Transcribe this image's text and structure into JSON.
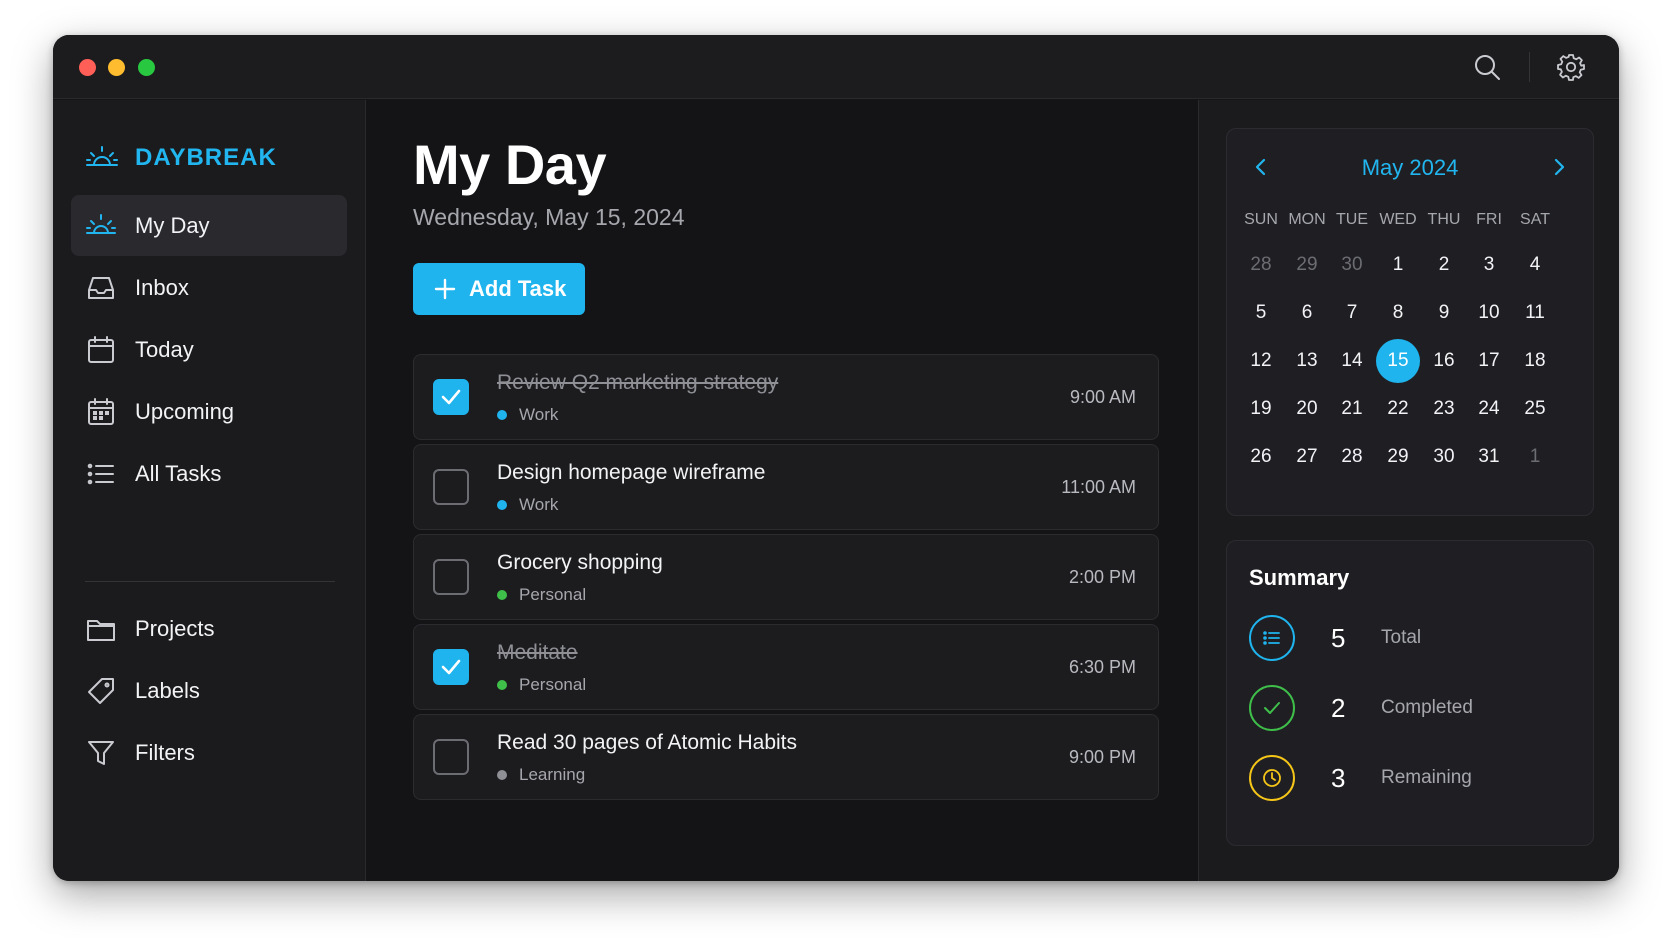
{
  "app": {
    "brand": "DAYBREAK",
    "accent": "#1fb4ee"
  },
  "titlebar": {
    "icons": [
      "search-icon",
      "gear-icon"
    ]
  },
  "sidebar": {
    "items": [
      {
        "label": "My Day",
        "icon": "sunrise-icon",
        "active": true
      },
      {
        "label": "Inbox",
        "icon": "inbox-icon"
      },
      {
        "label": "Today",
        "icon": "calendar-icon"
      },
      {
        "label": "Upcoming",
        "icon": "calendar-grid-icon"
      },
      {
        "label": "All Tasks",
        "icon": "list-icon"
      },
      {
        "label": "Projects",
        "icon": "folder-icon"
      },
      {
        "label": "Labels",
        "icon": "tag-icon"
      },
      {
        "label": "Filters",
        "icon": "filter-icon"
      }
    ]
  },
  "main": {
    "title": "My Day",
    "date": "Wednesday, May 15, 2024",
    "add_label": "Add Task",
    "tasks": [
      {
        "title": "Review Q2 marketing strategy",
        "tag": "Work",
        "tag_color": "#1fb4ee",
        "time": "9:00 AM",
        "done": true
      },
      {
        "title": "Design homepage wireframe",
        "tag": "Work",
        "tag_color": "#1fb4ee",
        "time": "11:00 AM",
        "done": false
      },
      {
        "title": "Grocery shopping",
        "tag": "Personal",
        "tag_color": "#3fbf4a",
        "time": "2:00 PM",
        "done": false
      },
      {
        "title": "Meditate",
        "tag": "Personal",
        "tag_color": "#3fbf4a",
        "time": "6:30 PM",
        "done": true
      },
      {
        "title": "Read 30 pages of Atomic Habits",
        "tag": "Learning",
        "tag_color": "#8e9096",
        "time": "9:00 PM",
        "done": false
      }
    ]
  },
  "calendar": {
    "month_label": "May 2024",
    "weekdays": [
      "SUN",
      "MON",
      "TUE",
      "WED",
      "THU",
      "FRI",
      "SAT"
    ],
    "weeks": [
      [
        "28",
        "29",
        "30",
        "1",
        "2",
        "3",
        "4"
      ],
      [
        "5",
        "6",
        "7",
        "8",
        "9",
        "10",
        "11"
      ],
      [
        "12",
        "13",
        "14",
        "15",
        "16",
        "17",
        "18"
      ],
      [
        "19",
        "20",
        "21",
        "22",
        "23",
        "24",
        "25"
      ],
      [
        "26",
        "27",
        "28",
        "29",
        "30",
        "31",
        "1"
      ]
    ],
    "muted": [
      "0-0",
      "0-1",
      "0-2",
      "4-6"
    ],
    "selected": "2-3"
  },
  "summary": {
    "title": "Summary",
    "rows": [
      {
        "value": "5",
        "label": "Total",
        "icon": "list-icon",
        "color": "#1fb4ee"
      },
      {
        "value": "2",
        "label": "Completed",
        "icon": "check-icon",
        "color": "#3fbf4a"
      },
      {
        "value": "3",
        "label": "Remaining",
        "icon": "clock-icon",
        "color": "#f5c518"
      }
    ]
  }
}
